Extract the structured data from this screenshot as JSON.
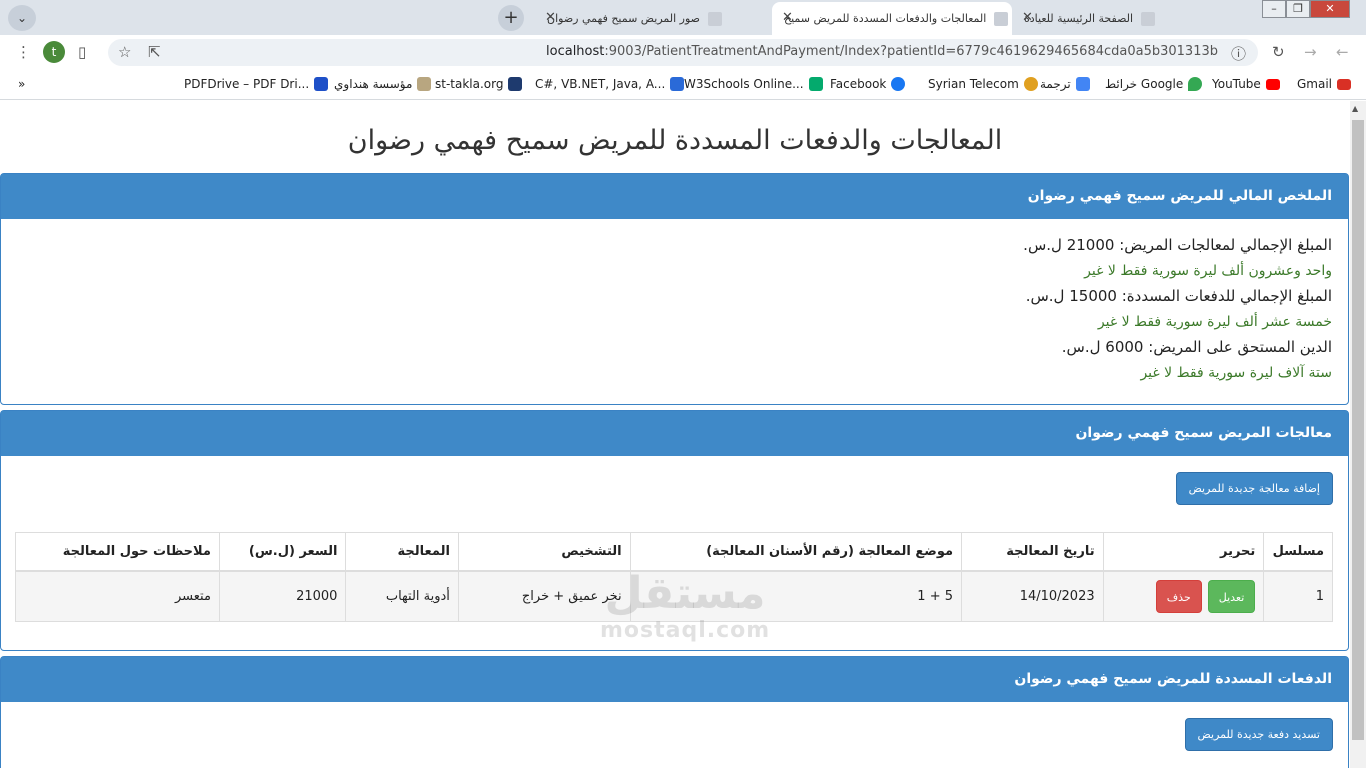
{
  "browser": {
    "tabs": [
      {
        "title": "الصفحة الرئيسية للعيادة"
      },
      {
        "title": "المعالجات والدفعات المسددة للمريض سميح"
      },
      {
        "title": "صور المريض سميح فهمي رضوان"
      }
    ],
    "url_host": "localhost",
    "url_path": ":9003/PatientTreatmentAndPayment/Index?patientId=6779c4619629465684cda0a5b301313b",
    "profile_initial": "t",
    "bookmarks": [
      {
        "label": "Gmail",
        "icon": "gmail-icon",
        "color": "#d93025"
      },
      {
        "label": "YouTube",
        "icon": "youtube-icon",
        "color": "#ff0000"
      },
      {
        "label": "خرائط Google",
        "icon": "maps-icon",
        "color": "#34a853"
      },
      {
        "label": "ترجمة",
        "icon": "translate-icon",
        "color": "#4285f4"
      },
      {
        "label": "Syrian Telecom",
        "icon": "syrian-telecom-icon",
        "color": "#e0a020"
      },
      {
        "label": "Facebook",
        "icon": "facebook-icon",
        "color": "#1877f2"
      },
      {
        "label": "W3Schools Online...",
        "icon": "w3schools-icon",
        "color": "#04aa6d"
      },
      {
        "label": "C#, VB.NET, Java, A...",
        "icon": "code-icon",
        "color": "#2a6ad8"
      },
      {
        "label": "st-takla.org",
        "icon": "st-takla-icon",
        "color": "#1e3a6e"
      },
      {
        "label": "مؤسسة هنداوي",
        "icon": "hindawi-icon",
        "color": "#b8a680"
      },
      {
        "label": "PDFDrive – PDF Dri...",
        "icon": "pdfdrive-icon",
        "color": "#1e50c8"
      }
    ],
    "more_bookmarks": "»"
  },
  "page": {
    "title": "المعالجات والدفعات المسددة للمريض سميح فهمي رضوان",
    "summary": {
      "heading": "الملخص المالي للمريض سميح فهمي رضوان",
      "total_treatments_label": "المبلغ الإجمالي لمعالجات المريض:",
      "total_treatments_value": "21000",
      "total_treatments_words": "واحد وعشرون ألف ليرة سورية فقط لا غير",
      "total_payments_label": "المبلغ الإجمالي للدفعات المسددة:",
      "total_payments_value": "15000",
      "total_payments_words": "خمسة عشر ألف ليرة سورية فقط لا غير",
      "debt_label": "الدين المستحق على المريض:",
      "debt_value": "6000",
      "debt_words": "ستة آلاف ليرة سورية فقط لا غير",
      "currency": "ل.س."
    },
    "treatments": {
      "heading": "معالجات المريض سميح فهمي رضوان",
      "add_button": "إضافة معالجة جديدة للمريض",
      "columns": [
        "مسلسل",
        "تحرير",
        "تاريخ المعالجة",
        "موضع المعالجة (رقم الأسنان المعالجة)",
        "التشخيص",
        "المعالجة",
        "السعر (ل.س)",
        "ملاحظات حول المعالجة"
      ],
      "rows": [
        {
          "serial": "1",
          "date": "14/10/2023",
          "location": "5 + 1",
          "diagnosis": "نخر عميق + خراج",
          "treatment": "أدوية التهاب",
          "price": "21000",
          "notes": "متعسر"
        }
      ],
      "edit_label": "تعديل",
      "delete_label": "حذف"
    },
    "payments": {
      "heading": "الدفعات المسددة للمريض سميح فهمي رضوان",
      "add_button": "تسديد دفعة جديدة للمريض"
    },
    "watermark": {
      "arabic": "مستقل",
      "latin": "mostaql.com"
    }
  }
}
